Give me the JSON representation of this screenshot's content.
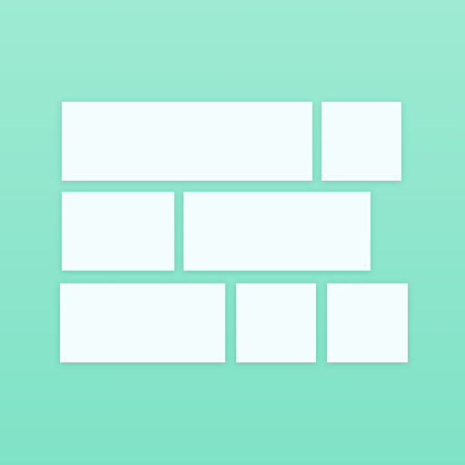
{
  "icon": {
    "name": "tiled-layout-icon",
    "background_colors": [
      "#9eead2",
      "#7fe2c6"
    ],
    "tile_color": "#f4fdfd",
    "rows": [
      {
        "tiles": [
          "tile-wide",
          "tile-square"
        ]
      },
      {
        "tiles": [
          "tile-medium",
          "tile-wide"
        ]
      },
      {
        "tiles": [
          "tile-wide",
          "tile-square",
          "tile-square"
        ]
      }
    ]
  }
}
